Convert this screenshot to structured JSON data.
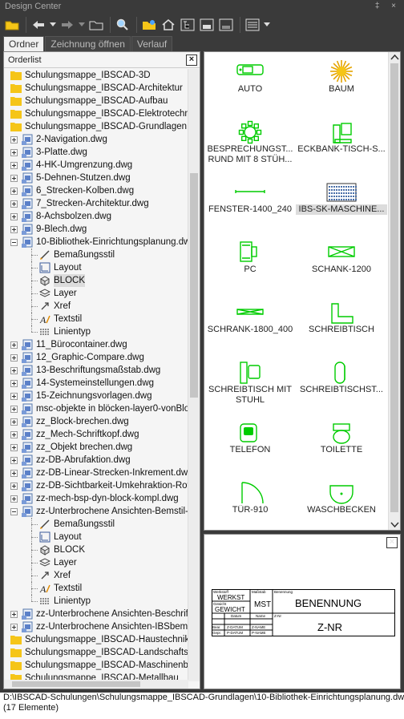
{
  "window": {
    "title": "Design Center",
    "title_icons": "‡ ×"
  },
  "tabs": [
    {
      "label": "Ordner",
      "active": true
    },
    {
      "label": "Zeichnung öffnen",
      "active": false
    },
    {
      "label": "Verlauf",
      "active": false
    }
  ],
  "tree_header": {
    "label": "Orderlist",
    "close": "×"
  },
  "tree": [
    {
      "level": 0,
      "type": "folder",
      "label": "Schulungsmappe_IBSCAD-3D"
    },
    {
      "level": 0,
      "type": "folder",
      "label": "Schulungsmappe_IBSCAD-Architektur"
    },
    {
      "level": 0,
      "type": "folder",
      "label": "Schulungsmappe_IBSCAD-Aufbau"
    },
    {
      "level": 0,
      "type": "folder",
      "label": "Schulungsmappe_IBSCAD-Elektrotechnik"
    },
    {
      "level": 0,
      "type": "folder",
      "label": "Schulungsmappe_IBSCAD-Grundlagen"
    },
    {
      "level": 1,
      "type": "dwg",
      "exp": "+",
      "label": "2-Navigation.dwg"
    },
    {
      "level": 1,
      "type": "dwg",
      "exp": "+",
      "label": "3-Platte.dwg"
    },
    {
      "level": 1,
      "type": "dwg",
      "exp": "+",
      "label": "4-HK-Umgrenzung.dwg"
    },
    {
      "level": 1,
      "type": "dwg",
      "exp": "+",
      "label": "5-Dehnen-Stutzen.dwg"
    },
    {
      "level": 1,
      "type": "dwg",
      "exp": "+",
      "label": "6_Strecken-Kolben.dwg"
    },
    {
      "level": 1,
      "type": "dwg",
      "exp": "+",
      "label": "7_Strecken-Architektur.dwg"
    },
    {
      "level": 1,
      "type": "dwg",
      "exp": "+",
      "label": "8-Achsbolzen.dwg"
    },
    {
      "level": 1,
      "type": "dwg",
      "exp": "+",
      "label": "9-Blech.dwg"
    },
    {
      "level": 1,
      "type": "dwg",
      "exp": "-",
      "label": "10-Bibliothek-Einrichtungsplanung.dwg"
    },
    {
      "level": 2,
      "type": "dim",
      "label": "Bemaßungsstil"
    },
    {
      "level": 2,
      "type": "layout",
      "label": "Layout"
    },
    {
      "level": 2,
      "type": "block",
      "label": "BLOCK",
      "selected": true
    },
    {
      "level": 2,
      "type": "layer",
      "label": "Layer"
    },
    {
      "level": 2,
      "type": "xref",
      "label": "Xref"
    },
    {
      "level": 2,
      "type": "text",
      "label": "Textstil"
    },
    {
      "level": 2,
      "type": "ltype",
      "label": "Linientyp",
      "last": true
    },
    {
      "level": 1,
      "type": "dwg",
      "exp": "+",
      "label": "11_Bürocontainer.dwg"
    },
    {
      "level": 1,
      "type": "dwg",
      "exp": "+",
      "label": "12_Graphic-Compare.dwg"
    },
    {
      "level": 1,
      "type": "dwg",
      "exp": "+",
      "label": "13-Beschriftungsmaßstab.dwg"
    },
    {
      "level": 1,
      "type": "dwg",
      "exp": "+",
      "label": "14-Systemeinstellungen.dwg"
    },
    {
      "level": 1,
      "type": "dwg",
      "exp": "+",
      "label": "15-Zeichnungsvorlagen.dwg"
    },
    {
      "level": 1,
      "type": "dwg",
      "exp": "+",
      "label": "msc-objekte in blöcken-layer0-vonBlock"
    },
    {
      "level": 1,
      "type": "dwg",
      "exp": "+",
      "label": "zz_Block-brechen.dwg"
    },
    {
      "level": 1,
      "type": "dwg",
      "exp": "+",
      "label": "zz_Mech-Schriftkopf.dwg"
    },
    {
      "level": 1,
      "type": "dwg",
      "exp": "+",
      "label": "zz_Objekt brechen.dwg"
    },
    {
      "level": 1,
      "type": "dwg",
      "exp": "+",
      "label": "zz-DB-Abrufaktion.dwg"
    },
    {
      "level": 1,
      "type": "dwg",
      "exp": "+",
      "label": "zz-DB-Linear-Strecken-Inkrement.dwg"
    },
    {
      "level": 1,
      "type": "dwg",
      "exp": "+",
      "label": "zz-DB-Sichtbarkeit-Umkehraktion-Rotat"
    },
    {
      "level": 1,
      "type": "dwg",
      "exp": "+",
      "label": "zz-mech-bsp-dyn-block-kompl.dwg"
    },
    {
      "level": 1,
      "type": "dwg",
      "exp": "-",
      "label": "zz-Unterbrochene Ansichten-Bemstil-oh"
    },
    {
      "level": 2,
      "type": "dim",
      "label": "Bemaßungsstil"
    },
    {
      "level": 2,
      "type": "layout",
      "label": "Layout"
    },
    {
      "level": 2,
      "type": "block",
      "label": "BLOCK"
    },
    {
      "level": 2,
      "type": "layer",
      "label": "Layer"
    },
    {
      "level": 2,
      "type": "xref",
      "label": "Xref"
    },
    {
      "level": 2,
      "type": "text",
      "label": "Textstil"
    },
    {
      "level": 2,
      "type": "ltype",
      "label": "Linientyp",
      "last": true
    },
    {
      "level": 1,
      "type": "dwg",
      "exp": "+",
      "label": "zz-Unterbrochene Ansichten-Beschriftu"
    },
    {
      "level": 1,
      "type": "dwg",
      "exp": "+",
      "label": "zz-Unterbrochene Ansichten-IBSbemas"
    },
    {
      "level": 0,
      "type": "folder",
      "label": "Schulungsmappe_IBSCAD-Haustechnik"
    },
    {
      "level": 0,
      "type": "folder",
      "label": "Schulungsmappe_IBSCAD-Landschaftsarc"
    },
    {
      "level": 0,
      "type": "folder",
      "label": "Schulungsmappe_IBSCAD-Maschinenbau"
    },
    {
      "level": 0,
      "type": "folder",
      "label": "Schulungsmappe_IBSCAD-Metallbau"
    }
  ],
  "blocks": [
    {
      "label": "AUTO",
      "icon": "car-icon"
    },
    {
      "label": "BAUM",
      "icon": "tree-icon"
    },
    {
      "label": "BESPRECHUNGST... RUND MIT 8 STÜH...",
      "icon": "round-table-icon"
    },
    {
      "label": "ECKBANK-TISCH-S...",
      "icon": "corner-bench-icon"
    },
    {
      "label": "FENSTER-1400_240",
      "icon": "window-icon"
    },
    {
      "label": "IBS-SK-MASCHINE...",
      "icon": "machine-icon",
      "selected": true
    },
    {
      "label": "PC",
      "icon": "pc-icon"
    },
    {
      "label": "SCHANK-1200",
      "icon": "cabinet-icon"
    },
    {
      "label": "SCHRANK-1800_400",
      "icon": "wardrobe-icon"
    },
    {
      "label": "SCHREIBTISCH",
      "icon": "desk-icon"
    },
    {
      "label": "SCHREIBTISCH MIT STUHL",
      "icon": "desk-chair-icon"
    },
    {
      "label": "SCHREIBTISCHST...",
      "icon": "desk-chair-2-icon"
    },
    {
      "label": "TELEFON",
      "icon": "phone-icon"
    },
    {
      "label": "TOILETTE",
      "icon": "toilet-icon"
    },
    {
      "label": "TÜR-910",
      "icon": "door-icon"
    },
    {
      "label": "WASCHBECKEN",
      "icon": "sink-icon"
    }
  ],
  "preview": {
    "close": "×",
    "werkstoff": "Werkstoff",
    "werkst": "WERKST",
    "gewicht_lbl": "Gewicht",
    "gewicht": "GEWICHT",
    "massstab": "Maßstab",
    "mst": "MST",
    "benennung_lbl": "Benennung",
    "benennung": "BENENNUNG",
    "datum": "Datum",
    "name": "Name",
    "znr_lbl": "Z-Nr",
    "bear": "Bear.",
    "gepr": "Gepr.",
    "zdatum": "Z-DATUM",
    "pdatum": "P-DATUM",
    "zname": "Z-NAME",
    "pname": "P-NAME",
    "znr": "Z-NR"
  },
  "status": {
    "path": "D:\\IBSCAD-Schulungen\\Schulungsmappe_IBSCAD-Grundlagen\\10-Bibliothek-Einrichtungsplanung.dwg\\Bl",
    "count": "(17 Elemente)"
  },
  "colors": {
    "block_green": "#00cc00",
    "folder_yellow": "#f5c518"
  }
}
